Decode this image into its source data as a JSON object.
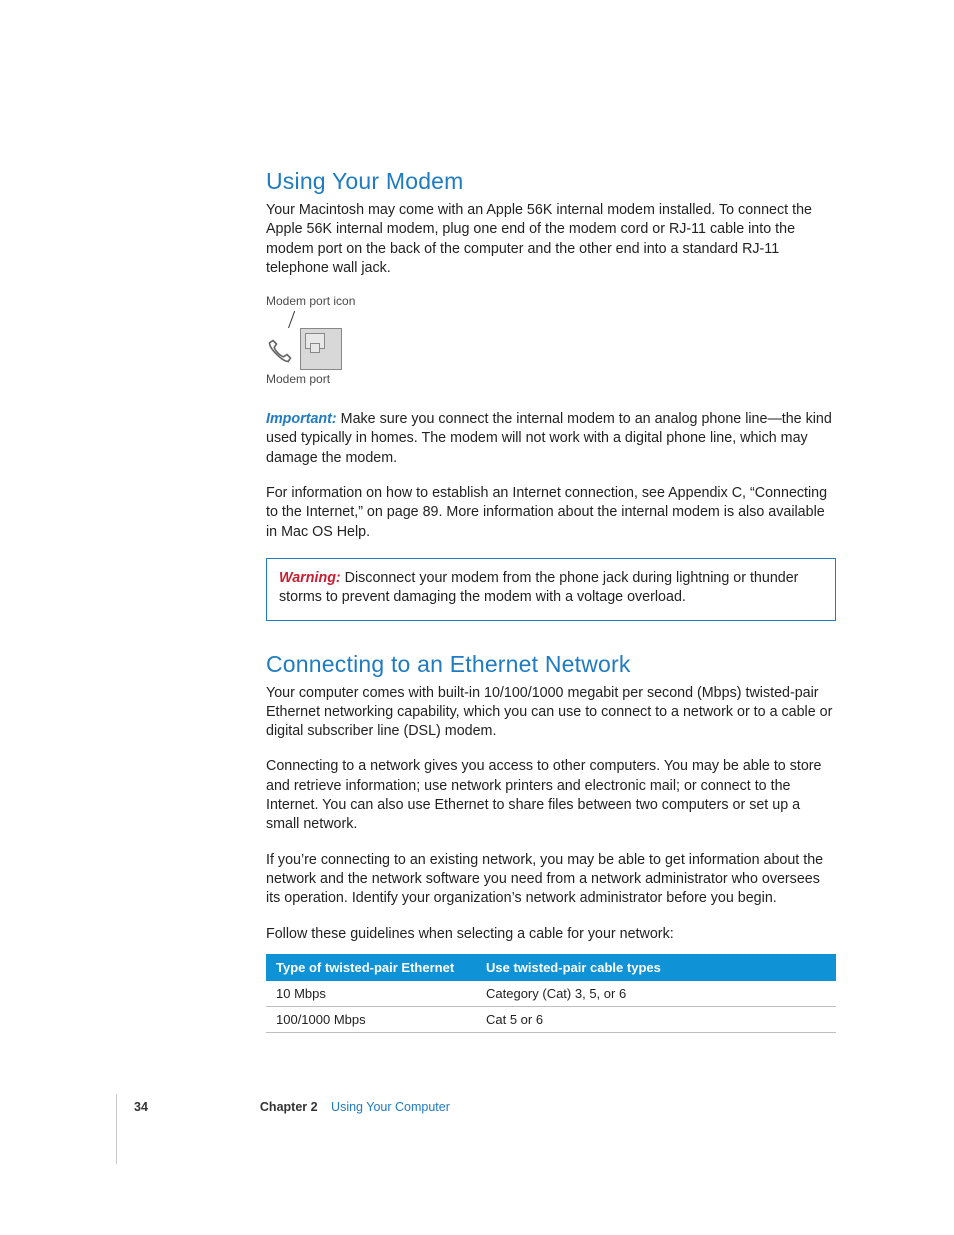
{
  "section1": {
    "heading": "Using Your Modem",
    "para1": "Your Macintosh may come with an Apple 56K internal modem installed. To connect the Apple 56K internal modem, plug one end of the modem cord or RJ-11 cable into the modem port on the back of the computer and the other end into a standard RJ-11 telephone wall jack.",
    "fig_top_label": "Modem port icon",
    "fig_bottom_label": "Modem port",
    "important_label": "Important:",
    "important_text": "  Make sure you connect the internal modem to an analog phone line—the kind used typically in homes. The modem will not work with a digital phone line, which may damage the modem.",
    "para3": "For information on how to establish an Internet connection, see Appendix C, “Connecting to the Internet,” on page 89. More information about the internal modem is also available in Mac OS Help.",
    "warning_label": "Warning:",
    "warning_text": "  Disconnect your modem from the phone jack during lightning or thunder storms to prevent damaging the modem with a voltage overload."
  },
  "section2": {
    "heading": "Connecting to an Ethernet Network",
    "para1": "Your computer comes with built-in 10/100/1000 megabit per second (Mbps) twisted-pair Ethernet networking capability, which you can use to connect to a network or to a cable or digital subscriber line (DSL) modem.",
    "para2": "Connecting to a network gives you access to other computers. You may be able to store and retrieve information; use network printers and electronic mail; or connect to the Internet. You can also use Ethernet to share files between two computers or set up a small network.",
    "para3": "If you’re connecting to an existing network, you may be able to get information about the network and the network software you need from a network administrator who oversees its operation. Identify your organization’s network administrator before you begin.",
    "para4": "Follow these guidelines when selecting a cable for your network:",
    "table": {
      "head1": "Type of twisted-pair Ethernet",
      "head2": "Use twisted-pair cable types",
      "rows": [
        {
          "c1": "10 Mbps",
          "c2": "Category (Cat) 3, 5, or 6"
        },
        {
          "c1": "100/1000 Mbps",
          "c2": "Cat 5 or 6"
        }
      ]
    }
  },
  "footer": {
    "pagenum": "34",
    "chapter_label": "Chapter 2",
    "chapter_title": "Using Your Computer"
  }
}
